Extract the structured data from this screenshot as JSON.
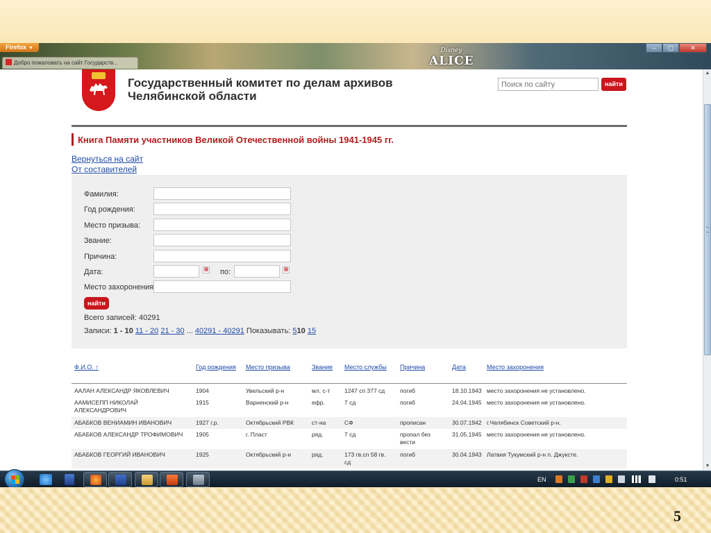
{
  "browser": {
    "app_button": "Firefox",
    "tab_title": "Добро пожаловать на сайт Государств...",
    "brand_line1": "Disney",
    "brand_line2": "ALICE",
    "controls": {
      "minimize": "–",
      "maximize": "▢",
      "close": "✕"
    }
  },
  "site": {
    "org_line1": "Государственный комитет по делам архивов",
    "org_line2": "Челябинской области",
    "search_placeholder": "Поиск по сайту",
    "search_button": "найти"
  },
  "page": {
    "book_title": "Книга Памяти участников Великой Отечественной войны 1941-1945 гг.",
    "links": [
      "Вернуться на сайт",
      "От составителей"
    ]
  },
  "form": {
    "surname_label": "Фамилия:",
    "birth_year_label": "Год рождения:",
    "draft_place_label": "Место призыва:",
    "rank_label": "Звание:",
    "reason_label": "Причина:",
    "date_label": "Дата:",
    "date_to_label": "по:",
    "burial_label": "Место захоронения:",
    "find_button": "найти",
    "total_text": "Всего записей: 40291",
    "pager": {
      "label": "Записи:",
      "current": "1 - 10",
      "pages": [
        "11 - 20",
        "21 - 30"
      ],
      "ellipsis": "...",
      "last": "40291 - 40291",
      "show_label": "Показывать:",
      "show_opts": [
        "5",
        "10",
        "15"
      ]
    }
  },
  "results": {
    "columns": [
      "Ф.И.О. ↑",
      "Год рождения",
      "Место призыва",
      "Звание",
      "Место службы",
      "Причина",
      "Дата",
      "Место захоронения"
    ],
    "rows": [
      [
        "ААЛАН АЛЕКСАНДР ЯКОВЛЕВИЧ",
        "1904",
        "Увельский р-н",
        "мл. с-т",
        "1247 сп 377 сд",
        "погиб",
        "18.10.1943",
        "место захоронения не установлено."
      ],
      [
        "ААМИСЕПП НИКОЛАЙ АЛЕКСАНДРОВИЧ",
        "1915",
        "Варненский р-н",
        "ефр.",
        "7 сд",
        "погиб",
        "24.04.1945",
        "место захоронения не установлено."
      ],
      [
        "АБАБКОВ ВЕНИАМИН ИВАНОВИЧ",
        "1927 г.р.",
        "Октябрьский РВК",
        "ст-на",
        "СФ",
        "прописан",
        "30.07.1942",
        "г.Челябинск Советский р-н."
      ],
      [
        "АБАБКОВ АЛЕКСАНДР ТРОФИМОВИЧ",
        "1905",
        "г. Пласт",
        "ряд.",
        "7 сд",
        "пропал без вести",
        "31.05.1945",
        "место захоронения не установлено."
      ],
      [
        "АБАБКОВ ГЕОРГИЙ ИВАНОВИЧ",
        "1925",
        "Октябрьский р-н",
        "ряд.",
        "173 гв.сп 58 гв. сд",
        "погиб",
        "30.04.1943",
        "Латвия Тукумский р-н п. Джуксте."
      ]
    ]
  },
  "taskbar": {
    "lang": "EN",
    "clock": "0:51"
  },
  "slide": {
    "number": "5"
  }
}
